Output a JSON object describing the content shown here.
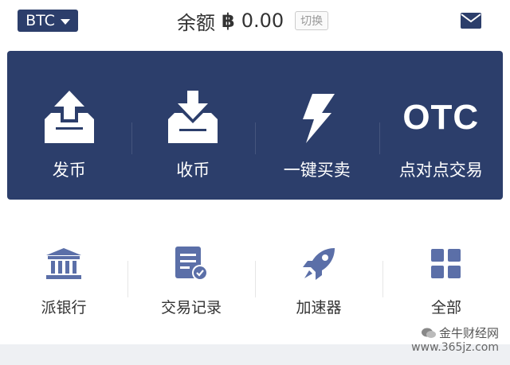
{
  "header": {
    "coin": "BTC",
    "balance_label": "余额",
    "currency_symbol": "฿",
    "balance_value": "0.00",
    "switch_label": "切换"
  },
  "panel": {
    "items": [
      {
        "label": "发币",
        "icon": "upload-tray-icon"
      },
      {
        "label": "收币",
        "icon": "download-tray-icon"
      },
      {
        "label": "一键买卖",
        "icon": "lightning-icon"
      },
      {
        "label": "点对点交易",
        "icon": "otc-icon",
        "icon_text": "OTC"
      }
    ]
  },
  "grid": {
    "items": [
      {
        "label": "派银行",
        "icon": "bank-icon"
      },
      {
        "label": "交易记录",
        "icon": "record-icon"
      },
      {
        "label": "加速器",
        "icon": "rocket-icon"
      },
      {
        "label": "全部",
        "icon": "all-grid-icon"
      }
    ]
  },
  "watermark": {
    "line1": "金牛财经网",
    "line2": "www.365jz.com"
  },
  "colors": {
    "brand": "#2c3e6b",
    "icon_blue": "#5b6fa8",
    "background": "#ffffff"
  }
}
